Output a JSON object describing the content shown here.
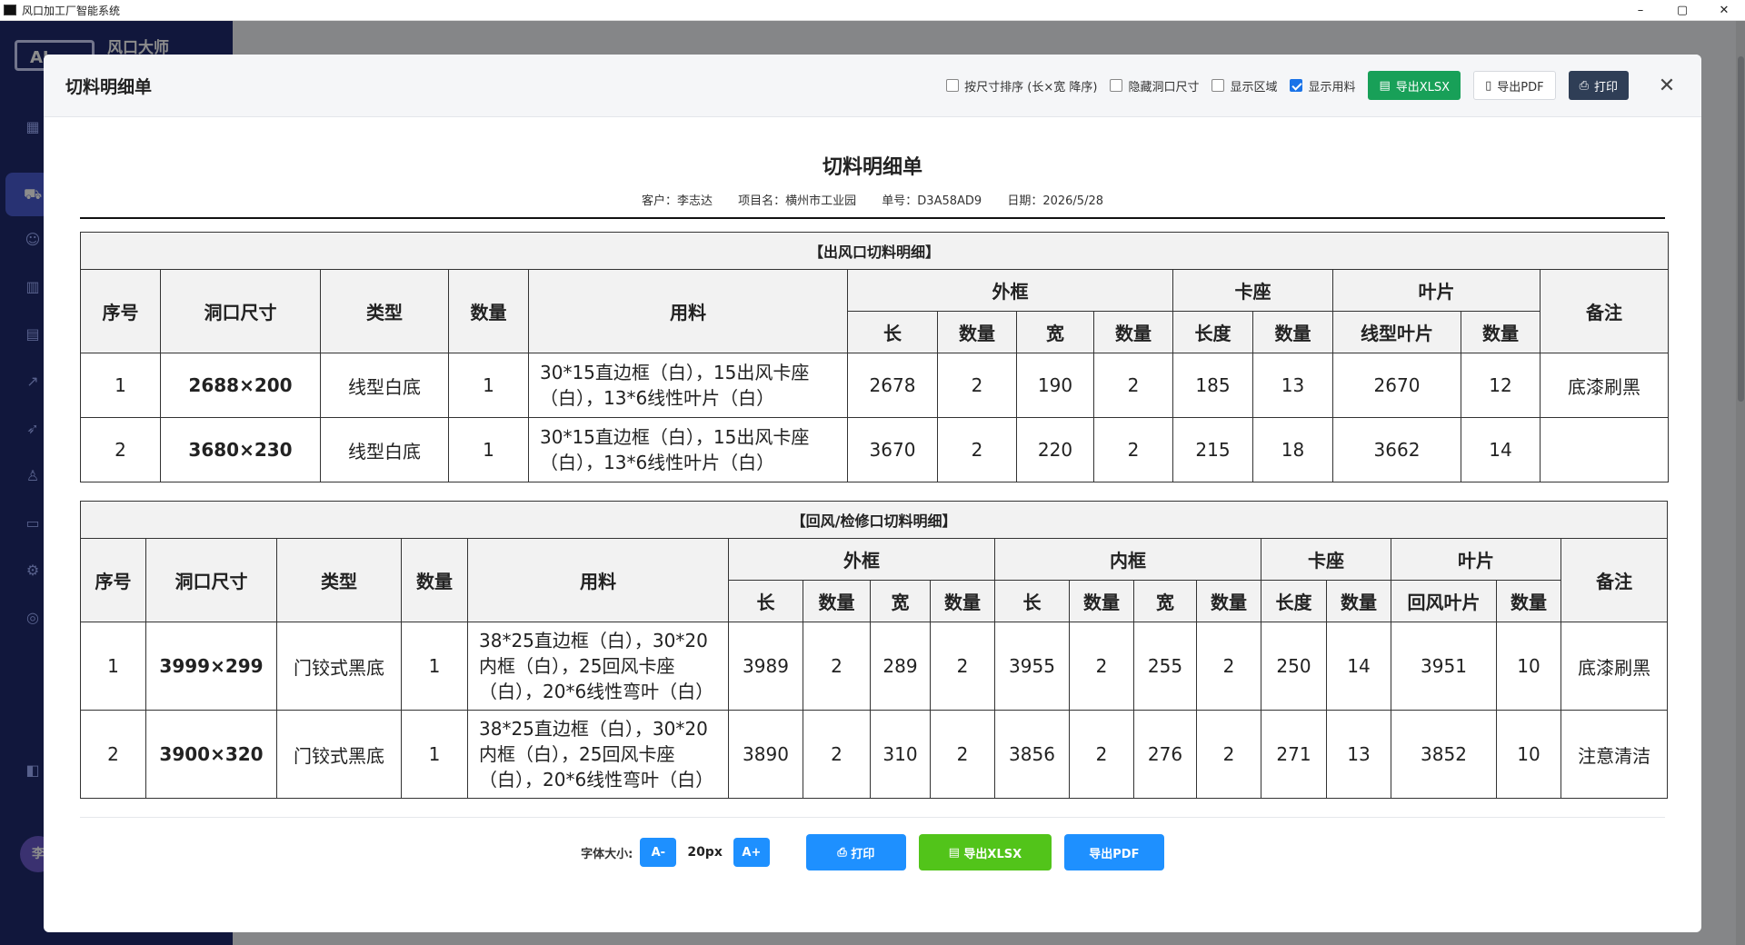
{
  "window": {
    "title": "风口加工厂智能系统",
    "minimize": "–",
    "maximize": "▢",
    "close": "✕"
  },
  "app": {
    "logo_text": "AI",
    "name": "风口大师",
    "avatar": "李"
  },
  "modal": {
    "title": "切料明细单",
    "options": [
      {
        "label": "按尺寸排序 (长×宽 降序)",
        "checked": false
      },
      {
        "label": "隐藏洞口尺寸",
        "checked": false
      },
      {
        "label": "显示区域",
        "checked": false
      },
      {
        "label": "显示用料",
        "checked": true
      }
    ],
    "btn_xlsx": "导出XLSX",
    "btn_pdf": "导出PDF",
    "btn_print": "打印",
    "close": "✕"
  },
  "doc": {
    "title": "切料明细单",
    "customer": "客户：李志达",
    "project": "项目名：横州市工业园",
    "order_no": "单号：D3A58AD9",
    "date": "日期：2026/5/28"
  },
  "table1": {
    "section": "【出风口切料明细】",
    "h": {
      "seq": "序号",
      "size": "洞口尺寸",
      "type": "类型",
      "qty": "数量",
      "material": "用料",
      "frame": "外框",
      "clip": "卡座",
      "blade": "叶片",
      "remark": "备注",
      "len": "长",
      "cnt": "数量",
      "wid": "宽",
      "length": "长度",
      "line_blade": "线型叶片"
    },
    "rows": [
      {
        "seq": "1",
        "size": "2688×200",
        "type": "线型白底",
        "qty": "1",
        "material": "30*15直边框（白），15出风卡座（白），13*6线性叶片（白）",
        "f_len": "2678",
        "f_n1": "2",
        "f_wid": "190",
        "f_n2": "2",
        "c_len": "185",
        "c_n": "13",
        "b_len": "2670",
        "b_n": "12",
        "remark": "底漆刷黑"
      },
      {
        "seq": "2",
        "size": "3680×230",
        "type": "线型白底",
        "qty": "1",
        "material": "30*15直边框（白），15出风卡座（白），13*6线性叶片（白）",
        "f_len": "3670",
        "f_n1": "2",
        "f_wid": "220",
        "f_n2": "2",
        "c_len": "215",
        "c_n": "18",
        "b_len": "3662",
        "b_n": "14",
        "remark": ""
      }
    ]
  },
  "table2": {
    "section": "【回风/检修口切料明细】",
    "h": {
      "seq": "序号",
      "size": "洞口尺寸",
      "type": "类型",
      "qty": "数量",
      "material": "用料",
      "frame": "外框",
      "inner": "内框",
      "clip": "卡座",
      "blade": "叶片",
      "remark": "备注",
      "len": "长",
      "cnt": "数量",
      "wid": "宽",
      "length": "长度",
      "return_blade": "回风叶片"
    },
    "rows": [
      {
        "seq": "1",
        "size": "3999×299",
        "type": "门铰式黑底",
        "qty": "1",
        "material": "38*25直边框（白），30*20内框（白），25回风卡座（白），20*6线性弯叶（白）",
        "f_len": "3989",
        "f_n1": "2",
        "f_wid": "289",
        "f_n2": "2",
        "i_len": "3955",
        "i_n1": "2",
        "i_wid": "255",
        "i_n2": "2",
        "c_len": "250",
        "c_n": "14",
        "b_len": "3951",
        "b_n": "10",
        "remark": "底漆刷黑"
      },
      {
        "seq": "2",
        "size": "3900×320",
        "type": "门铰式黑底",
        "qty": "1",
        "material": "38*25直边框（白），30*20内框（白），25回风卡座（白），20*6线性弯叶（白）",
        "f_len": "3890",
        "f_n1": "2",
        "f_wid": "310",
        "f_n2": "2",
        "i_len": "3856",
        "i_n1": "2",
        "i_wid": "276",
        "i_n2": "2",
        "c_len": "271",
        "c_n": "13",
        "b_len": "3852",
        "b_n": "10",
        "remark": "注意清洁"
      }
    ]
  },
  "footer": {
    "font_label": "字体大小:",
    "dec": "A-",
    "font_value": "20px",
    "inc": "A+",
    "print": "打印",
    "xlsx": "导出XLSX",
    "pdf": "导出PDF"
  }
}
